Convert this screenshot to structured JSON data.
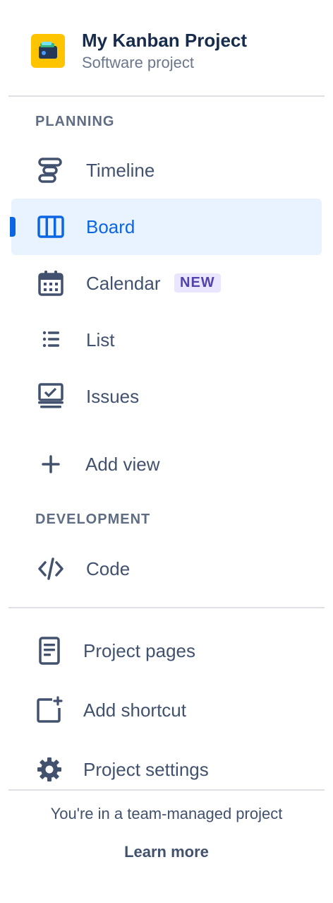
{
  "project": {
    "name": "My Kanban Project",
    "type": "Software project"
  },
  "sections": {
    "planning": "PLANNING",
    "development": "DEVELOPMENT"
  },
  "nav": {
    "timeline": "Timeline",
    "board": "Board",
    "calendar": "Calendar",
    "calendar_badge": "NEW",
    "list": "List",
    "issues": "Issues",
    "add_view": "Add view",
    "code": "Code",
    "project_pages": "Project pages",
    "add_shortcut": "Add shortcut",
    "project_settings": "Project settings"
  },
  "footer": {
    "text": "You're in a team-managed project",
    "link": "Learn more"
  },
  "colors": {
    "accent": "#0C66E4",
    "selected_bg": "#E9F2FF",
    "project_icon": "#FFC400",
    "badge_bg": "#EAE6FF",
    "badge_text": "#5243AA"
  },
  "icons": {
    "project": "wallet-icon",
    "timeline": "timeline-icon",
    "board": "board-icon",
    "calendar": "calendar-icon",
    "list": "list-icon",
    "issues": "issues-icon",
    "add_view": "plus-icon",
    "code": "code-icon",
    "project_pages": "page-icon",
    "add_shortcut": "add-shortcut-icon",
    "project_settings": "gear-icon"
  }
}
